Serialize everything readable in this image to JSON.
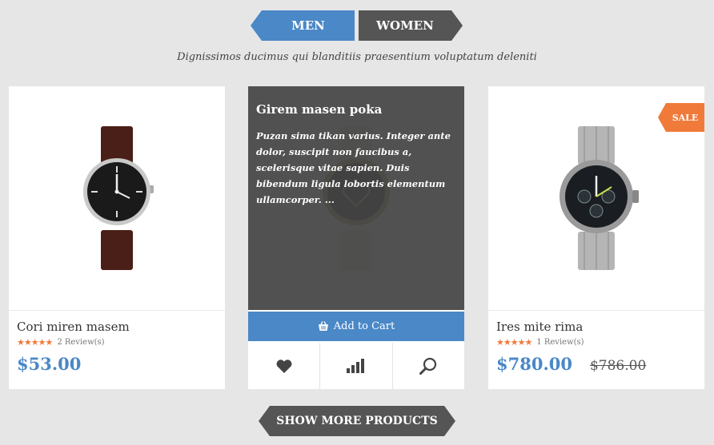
{
  "tabs": [
    {
      "label": "MEN",
      "active": true
    },
    {
      "label": "WOMEN",
      "active": false
    }
  ],
  "subtitle": "Dignissimos ducimus qui blanditiis praesentium voluptatum deleniti",
  "products": [
    {
      "name": "Cori miren masem",
      "stars": "★★★★★",
      "reviews": "2 Review(s)",
      "price": "$53.00",
      "image_icon": "leather-watch-image"
    },
    {
      "name": "Girem masen poka",
      "description": "Puzan sima tikan varius. Integer ante dolor, suscipit non faucibus a, scelerisque vitae sapien. Duis bibendum ligula lobortis elementum ullamcorper. ...",
      "add_to_cart": "Add to Cart",
      "image_icon": "heart-dial-watch-image",
      "actions": [
        "heart-icon",
        "compare-icon",
        "search-icon"
      ]
    },
    {
      "name": "Ires mite rima",
      "stars": "★★★★★",
      "reviews": "1 Review(s)",
      "price": "$780.00",
      "old_price": "$786.00",
      "badge": "SALE",
      "image_icon": "steel-chronograph-watch-image"
    }
  ],
  "show_more": "SHOW MORE PRODUCTS",
  "colors": {
    "accent": "#4a88c7",
    "dark": "#555555",
    "sale": "#f07a3a",
    "background": "#e6e6e6"
  }
}
